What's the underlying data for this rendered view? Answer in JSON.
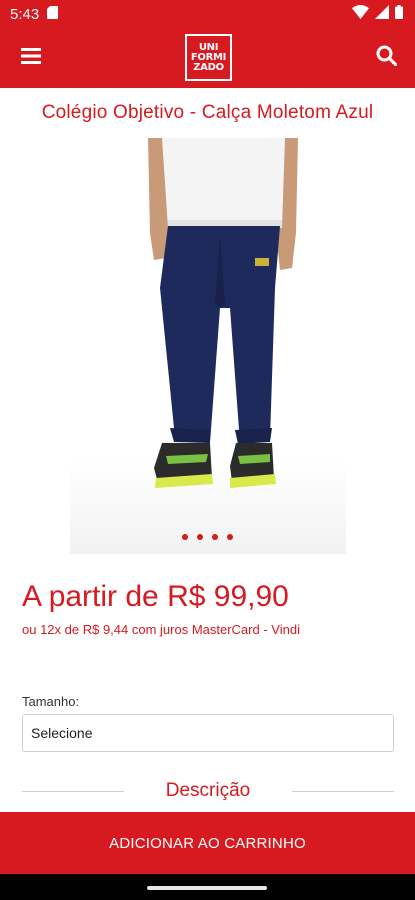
{
  "status_bar": {
    "time": "5:43"
  },
  "app_bar": {
    "logo_lines": [
      "UNI",
      "FORMI",
      "ZADO"
    ]
  },
  "product": {
    "title": "Colégio Objetivo - Calça Moletom Azul",
    "carousel_dots": 4,
    "price": "A partir de R$ 99,90",
    "installments": "ou 12x de R$ 9,44 com juros MasterCard - Vindi"
  },
  "size": {
    "label": "Tamanho:",
    "selected": "Selecione"
  },
  "description": {
    "title": "Descrição"
  },
  "cart": {
    "button_label": "ADICIONAR AO CARRINHO"
  },
  "colors": {
    "brand_red": "#d71920",
    "pants_navy": "#1f2a5c",
    "shirt_white": "#f4f4f4"
  }
}
